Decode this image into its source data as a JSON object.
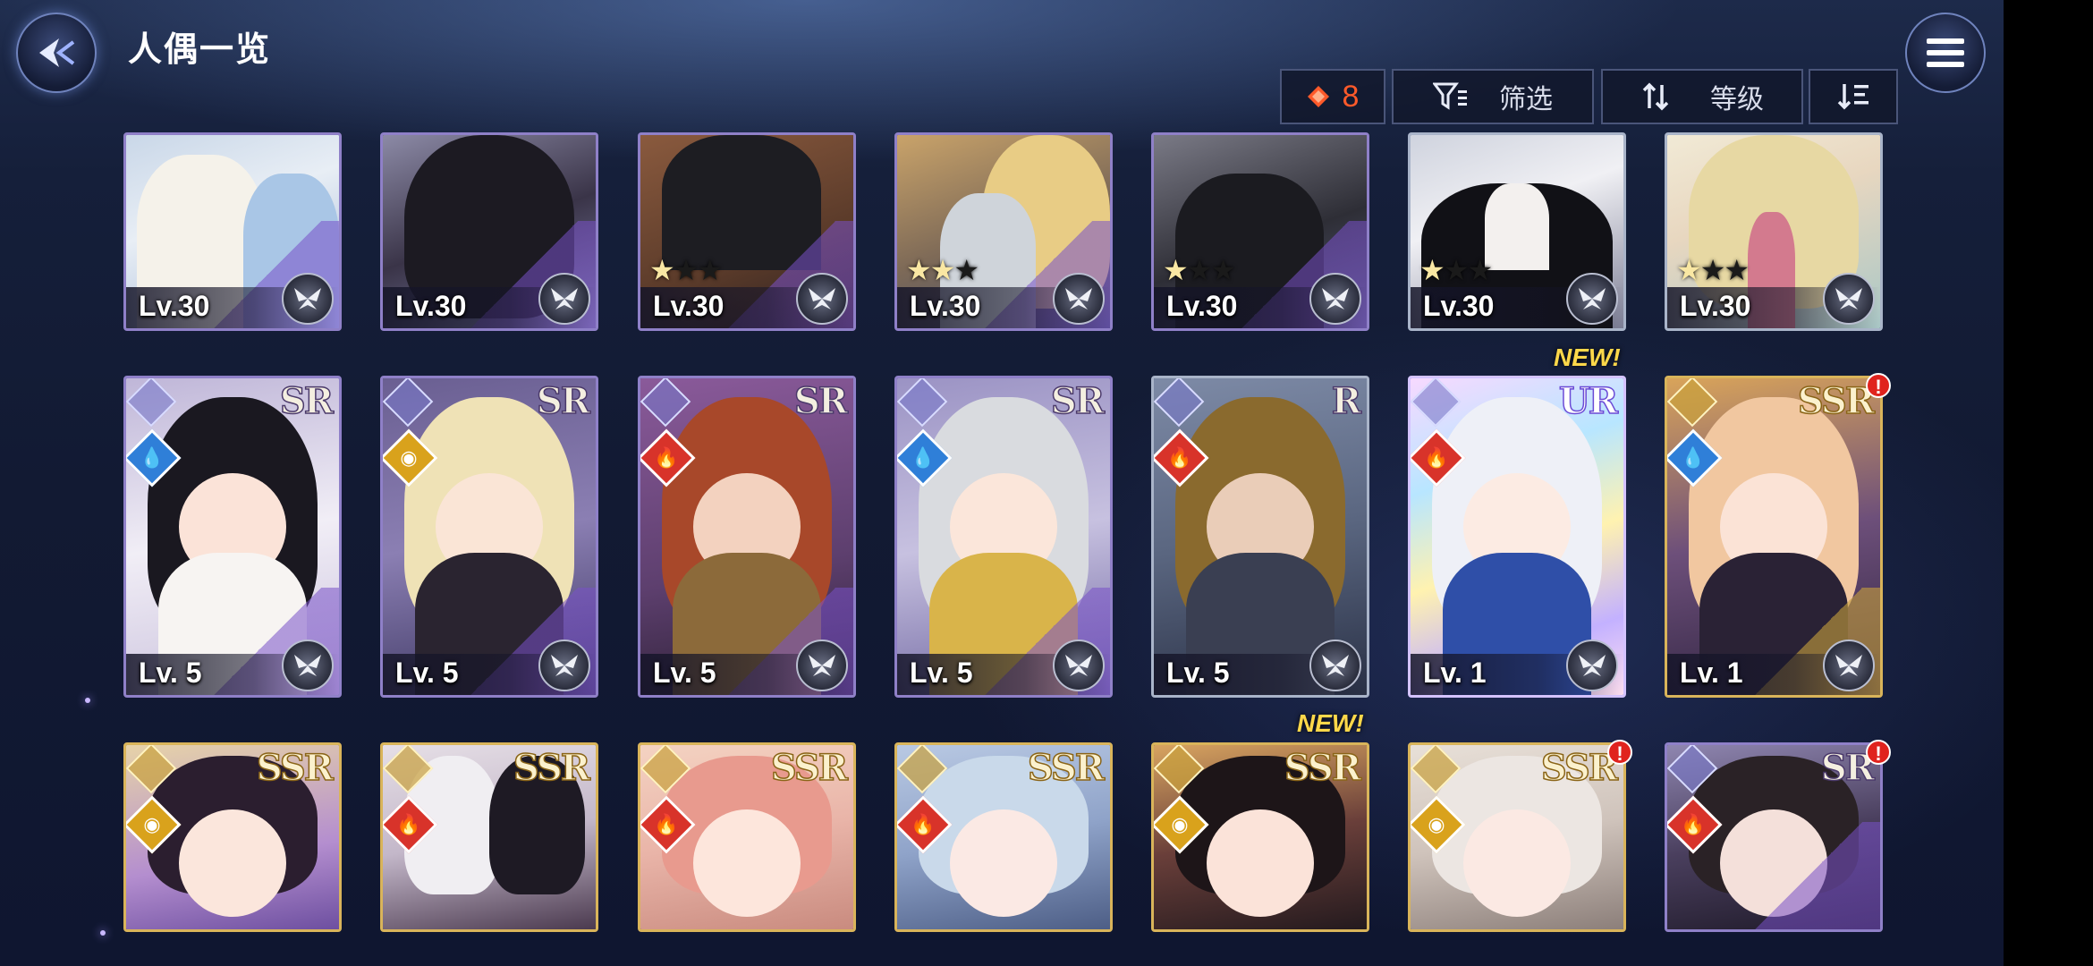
{
  "header": {
    "title": "人偶一览"
  },
  "toolbar": {
    "count": "8",
    "filter_label": "筛选",
    "sort_label": "等级"
  },
  "colors": {
    "accent": "#ff5a2a",
    "new_tag": "#ffd84a",
    "alert": "#e0231e"
  },
  "rows": [
    {
      "cards": [
        {
          "level": "Lv.30",
          "stars": 0
        },
        {
          "level": "Lv.30",
          "stars": 0
        },
        {
          "level": "Lv.30",
          "stars": 1
        },
        {
          "level": "Lv.30",
          "stars": 2
        },
        {
          "level": "Lv.30",
          "stars": 1
        },
        {
          "level": "Lv.30",
          "stars": 1
        },
        {
          "level": "Lv.30",
          "stars": 1
        }
      ]
    },
    {
      "cards": [
        {
          "level": "Lv. 5",
          "rarity": "SR",
          "element": "water"
        },
        {
          "level": "Lv. 5",
          "rarity": "SR",
          "element": "light"
        },
        {
          "level": "Lv. 5",
          "rarity": "SR",
          "element": "fire"
        },
        {
          "level": "Lv. 5",
          "rarity": "SR",
          "element": "water"
        },
        {
          "level": "Lv. 5",
          "rarity": "R",
          "element": "fire"
        },
        {
          "level": "Lv. 1",
          "rarity": "UR",
          "element": "fire",
          "new_label": "NEW!"
        },
        {
          "level": "Lv. 1",
          "rarity": "SSR",
          "element": "water",
          "alert": "!"
        }
      ]
    },
    {
      "cards": [
        {
          "rarity": "SSR",
          "element": "light"
        },
        {
          "rarity": "SSR",
          "element": "fire"
        },
        {
          "rarity": "SSR",
          "element": "fire"
        },
        {
          "rarity": "SSR",
          "element": "fire"
        },
        {
          "rarity": "SSR",
          "element": "light",
          "new_label": "NEW!"
        },
        {
          "rarity": "SSR",
          "element": "light",
          "alert": "!"
        },
        {
          "rarity": "SR",
          "element": "fire",
          "alert": "!"
        }
      ]
    }
  ]
}
